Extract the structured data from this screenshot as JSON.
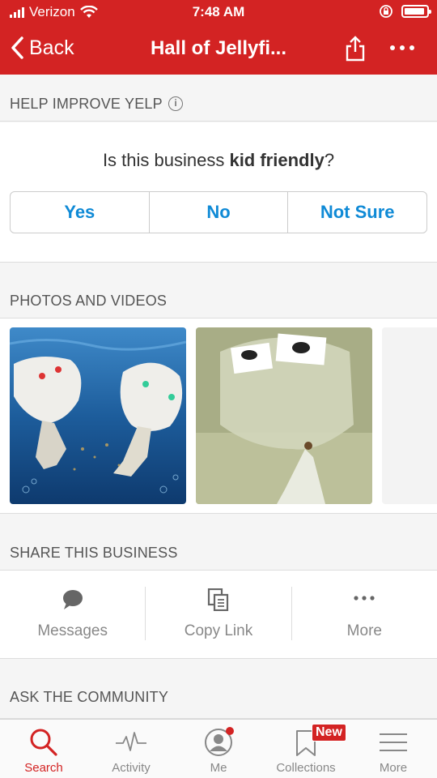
{
  "status_bar": {
    "carrier": "Verizon",
    "time": "7:48 AM"
  },
  "nav": {
    "back_label": "Back",
    "title": "Hall of Jellyfi..."
  },
  "help": {
    "header": "HELP IMPROVE YELP",
    "question_prefix": "Is this business ",
    "question_bold": "kid friendly",
    "question_suffix": "?",
    "answers": [
      "Yes",
      "No",
      "Not Sure"
    ]
  },
  "photos": {
    "header": "PHOTOS AND VIDEOS"
  },
  "share": {
    "header": "SHARE THIS BUSINESS",
    "items": [
      {
        "label": "Messages",
        "icon": "speech-bubble-icon"
      },
      {
        "label": "Copy Link",
        "icon": "copy-link-icon"
      },
      {
        "label": "More",
        "icon": "more-dots-icon"
      }
    ]
  },
  "community": {
    "header": "ASK THE COMMUNITY"
  },
  "tabbar": {
    "items": [
      {
        "label": "Search",
        "icon": "search-icon",
        "active": true
      },
      {
        "label": "Activity",
        "icon": "activity-icon"
      },
      {
        "label": "Me",
        "icon": "user-icon"
      },
      {
        "label": "Collections",
        "icon": "bookmark-icon"
      },
      {
        "label": "More",
        "icon": "menu-icon"
      }
    ],
    "collections_badge": "New"
  },
  "colors": {
    "brand": "#d32323",
    "link": "#0f8ad6"
  }
}
